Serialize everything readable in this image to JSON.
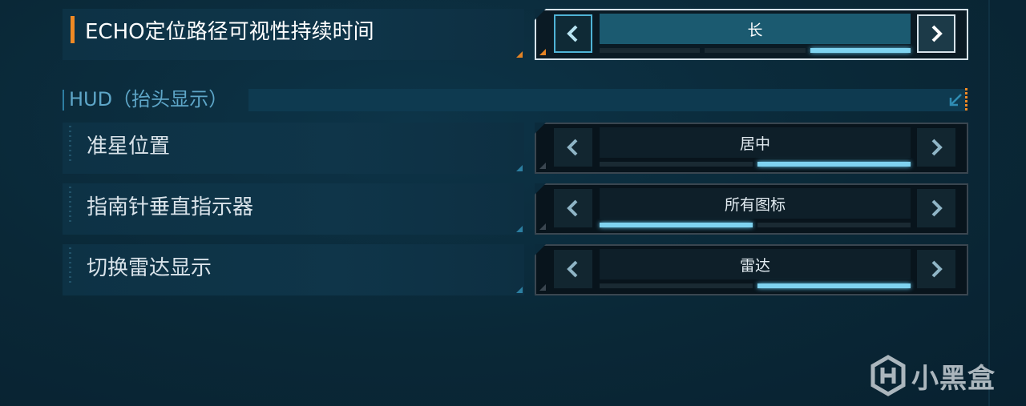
{
  "settings": {
    "echo_row": {
      "label": "ECHO定位路径可视性持续时间",
      "value": "长",
      "steps_total": 3,
      "steps_active": [
        3
      ]
    },
    "hud_section": {
      "title": "HUD（抬头显示）"
    },
    "crosshair_row": {
      "label": "准星位置",
      "value": "居中",
      "steps_total": 2,
      "steps_active": [
        2
      ]
    },
    "compass_row": {
      "label": "指南针垂直指示器",
      "value": "所有图标",
      "steps_total": 2,
      "steps_active": [
        1
      ]
    },
    "radar_row": {
      "label": "切换雷达显示",
      "value": "雷达",
      "steps_total": 2,
      "steps_active": [
        2
      ]
    }
  },
  "icons": {
    "left_arrow": "chevron-left-icon",
    "right_arrow": "chevron-right-icon",
    "collapse": "arrow-down-left-icon"
  },
  "watermark": {
    "text": "小黑盒"
  },
  "colors": {
    "accent_orange": "#f08a24",
    "accent_blue": "#7fd3f0",
    "selected_value_bg": "#1b5a70"
  }
}
